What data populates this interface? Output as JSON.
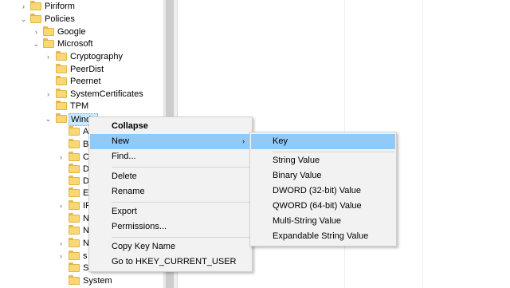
{
  "tree": {
    "items": [
      {
        "label": "Piriform",
        "expander": "right"
      },
      {
        "label": "Policies",
        "expander": "down"
      },
      {
        "label": "Google",
        "expander": "right"
      },
      {
        "label": "Microsoft",
        "expander": "down"
      },
      {
        "label": "Cryptography",
        "expander": "right"
      },
      {
        "label": "PeerDist",
        "expander": ""
      },
      {
        "label": "Peernet",
        "expander": ""
      },
      {
        "label": "SystemCertificates",
        "expander": "right"
      },
      {
        "label": "TPM",
        "expander": ""
      },
      {
        "label": "Windo",
        "expander": "down"
      },
      {
        "label": "A",
        "expander": ""
      },
      {
        "label": "B",
        "expander": ""
      },
      {
        "label": "C",
        "expander": "right"
      },
      {
        "label": "D",
        "expander": ""
      },
      {
        "label": "D",
        "expander": ""
      },
      {
        "label": "E",
        "expander": ""
      },
      {
        "label": "IP",
        "expander": "right"
      },
      {
        "label": "N",
        "expander": ""
      },
      {
        "label": "N",
        "expander": ""
      },
      {
        "label": "N",
        "expander": "right"
      },
      {
        "label": "s",
        "expander": "right"
      },
      {
        "label": "S",
        "expander": ""
      },
      {
        "label": "System",
        "expander": ""
      }
    ]
  },
  "context_menu": {
    "items": [
      {
        "label": "Collapse"
      },
      {
        "label": "New"
      },
      {
        "label": "Find..."
      },
      {
        "label": "Delete"
      },
      {
        "label": "Rename"
      },
      {
        "label": "Export"
      },
      {
        "label": "Permissions..."
      },
      {
        "label": "Copy Key Name"
      },
      {
        "label": "Go to HKEY_CURRENT_USER"
      }
    ],
    "submenu_arrow": "›"
  },
  "new_submenu": {
    "items": [
      {
        "label": "Key"
      },
      {
        "label": "String Value"
      },
      {
        "label": "Binary Value"
      },
      {
        "label": "DWORD (32-bit) Value"
      },
      {
        "label": "QWORD (64-bit) Value"
      },
      {
        "label": "Multi-String Value"
      },
      {
        "label": "Expandable String Value"
      }
    ]
  },
  "glyphs": {
    "expand_right": "›",
    "expand_down": "⌄"
  },
  "colors": {
    "highlight": "#91c9f7",
    "menu_bg": "#f2f2f2",
    "folder": "#f8d775"
  }
}
